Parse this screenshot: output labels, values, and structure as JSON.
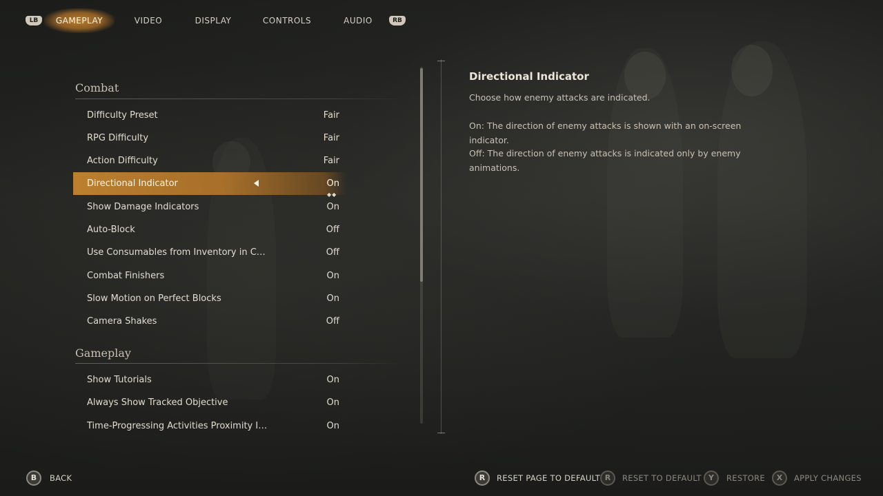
{
  "tabs": {
    "left_bumper": "LB",
    "right_bumper": "RB",
    "items": [
      {
        "label": "GAMEPLAY"
      },
      {
        "label": "VIDEO"
      },
      {
        "label": "DISPLAY"
      },
      {
        "label": "CONTROLS"
      },
      {
        "label": "AUDIO"
      }
    ],
    "active": "GAMEPLAY"
  },
  "sections": {
    "combat": {
      "title": "Combat",
      "rows": [
        {
          "label": "Difficulty Preset",
          "value": "Fair"
        },
        {
          "label": "RPG Difficulty",
          "value": "Fair"
        },
        {
          "label": "Action Difficulty",
          "value": "Fair"
        },
        {
          "label": "Directional Indicator",
          "value": "On"
        },
        {
          "label": "Show Damage Indicators",
          "value": "On"
        },
        {
          "label": "Auto-Block",
          "value": "Off"
        },
        {
          "label": "Use Consumables from Inventory in C…",
          "value": "Off"
        },
        {
          "label": "Combat Finishers",
          "value": "On"
        },
        {
          "label": "Slow Motion on Perfect Blocks",
          "value": "On"
        },
        {
          "label": "Camera Shakes",
          "value": "Off"
        }
      ]
    },
    "gameplay": {
      "title": "Gameplay",
      "rows": [
        {
          "label": "Show Tutorials",
          "value": "On"
        },
        {
          "label": "Always Show Tracked Objective",
          "value": "On"
        },
        {
          "label": "Time-Progressing Activities Proximity I…",
          "value": "On"
        }
      ]
    }
  },
  "selected_row": "Directional Indicator",
  "description": {
    "title": "Directional Indicator",
    "paragraphs": [
      "Choose how enemy attacks are indicated.",
      "On: The direction of enemy attacks is shown with an on-screen indicator.",
      "Off: The direction of enemy attacks is indicated only by enemy animations."
    ]
  },
  "footer": {
    "back": {
      "glyph": "B",
      "label": "BACK"
    },
    "reset_page": {
      "glyph": "R",
      "label": "RESET PAGE TO DEFAULT"
    },
    "reset_default": {
      "glyph": "R",
      "label": "RESET TO DEFAULT"
    },
    "restore": {
      "glyph": "Y",
      "label": "RESTORE"
    },
    "apply": {
      "glyph": "X",
      "label": "APPLY CHANGES"
    }
  },
  "colors": {
    "accent": "#c4842f",
    "background": "#1f201e",
    "text": "#e2dcd0"
  }
}
